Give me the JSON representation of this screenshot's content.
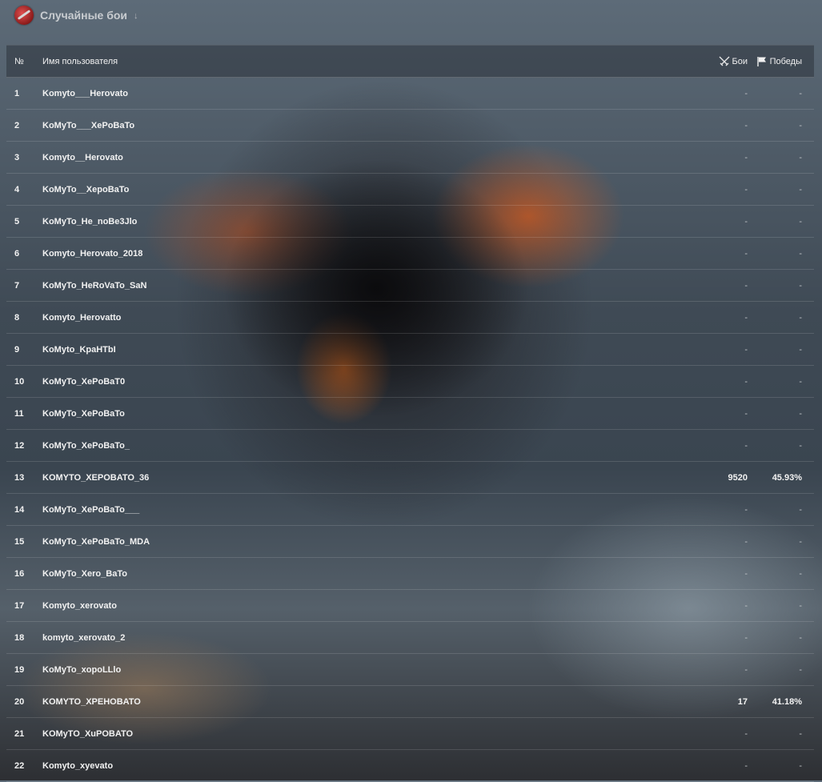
{
  "header": {
    "title": "Случайные бои",
    "dropdown_icon": "↓",
    "logo_icon": "game-mode-logo-icon"
  },
  "table": {
    "columns": {
      "num": "№",
      "name": "Имя пользователя",
      "battles": "Бои",
      "wins": "Победы",
      "battles_icon": "crossed-swords-icon",
      "wins_icon": "flag-icon"
    },
    "rows": [
      {
        "num": "1",
        "name": "Komyto___Herovato",
        "battles": "-",
        "wins": "-"
      },
      {
        "num": "2",
        "name": "KoMyTo___XePoBaTo",
        "battles": "-",
        "wins": "-"
      },
      {
        "num": "3",
        "name": "Komyto__Herovato",
        "battles": "-",
        "wins": "-"
      },
      {
        "num": "4",
        "name": "KoMyTo__XepoBaTo",
        "battles": "-",
        "wins": "-"
      },
      {
        "num": "5",
        "name": "KoMyTo_He_noBe3Jlo",
        "battles": "-",
        "wins": "-"
      },
      {
        "num": "6",
        "name": "Komyto_Herovato_2018",
        "battles": "-",
        "wins": "-"
      },
      {
        "num": "7",
        "name": "KoMyTo_HeRoVaTo_SaN",
        "battles": "-",
        "wins": "-"
      },
      {
        "num": "8",
        "name": "Komyto_Herovatto",
        "battles": "-",
        "wins": "-"
      },
      {
        "num": "9",
        "name": "KoMyto_KpaHTbI",
        "battles": "-",
        "wins": "-"
      },
      {
        "num": "10",
        "name": "KoMyTo_XePoBaT0",
        "battles": "-",
        "wins": "-"
      },
      {
        "num": "11",
        "name": "KoMyTo_XePoBaTo",
        "battles": "-",
        "wins": "-"
      },
      {
        "num": "12",
        "name": "KoMyTo_XePoBaTo_",
        "battles": "-",
        "wins": "-"
      },
      {
        "num": "13",
        "name": "KOMYTO_XEPOBATO_36",
        "battles": "9520",
        "wins": "45.93%"
      },
      {
        "num": "14",
        "name": "KoMyTo_XePoBaTo___",
        "battles": "-",
        "wins": "-"
      },
      {
        "num": "15",
        "name": "KoMyTo_XePoBaTo_MDA",
        "battles": "-",
        "wins": "-"
      },
      {
        "num": "16",
        "name": "KoMyTo_Xero_BaTo",
        "battles": "-",
        "wins": "-"
      },
      {
        "num": "17",
        "name": "Komyto_xerovato",
        "battles": "-",
        "wins": "-"
      },
      {
        "num": "18",
        "name": "komyto_xerovato_2",
        "battles": "-",
        "wins": "-"
      },
      {
        "num": "19",
        "name": "KoMyTo_xopoLLlo",
        "battles": "-",
        "wins": "-"
      },
      {
        "num": "20",
        "name": "KOMYTO_XPEHOBATO",
        "battles": "17",
        "wins": "41.18%"
      },
      {
        "num": "21",
        "name": "KOMyTO_XuPOBATO",
        "battles": "-",
        "wins": "-"
      },
      {
        "num": "22",
        "name": "Komyto_xyevato",
        "battles": "-",
        "wins": "-"
      }
    ]
  }
}
